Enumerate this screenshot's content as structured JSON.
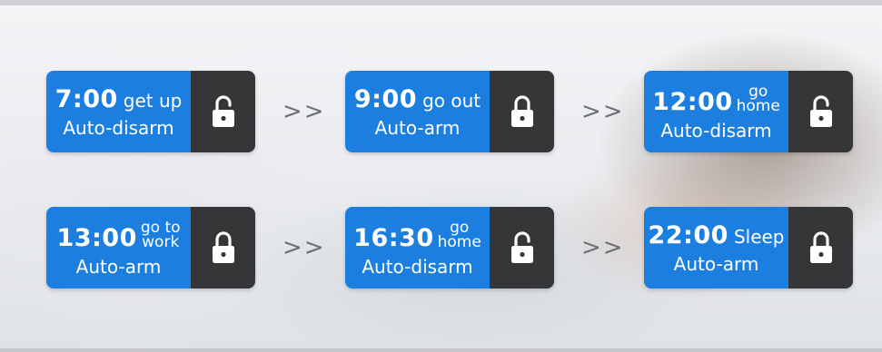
{
  "schedule": [
    {
      "time": "7:00",
      "event": "get up",
      "stacked": false,
      "action": "Auto-disarm",
      "icon": "padlock-icon"
    },
    {
      "time": "9:00",
      "event": "go out",
      "stacked": false,
      "action": "Auto-arm",
      "icon": "padlock-icon"
    },
    {
      "time": "12:00",
      "event_line1": "go",
      "event_line2": "home",
      "stacked": true,
      "action": "Auto-disarm",
      "icon": "padlock-icon"
    },
    {
      "time": "13:00",
      "event_line1": "go to",
      "event_line2": "work",
      "stacked": true,
      "action": "Auto-arm",
      "icon": "padlock-icon"
    },
    {
      "time": "16:30",
      "event_line1": "go",
      "event_line2": "home",
      "stacked": true,
      "action": "Auto-disarm",
      "icon": "padlock-icon"
    },
    {
      "time": "22:00",
      "event": "Sleep",
      "stacked": false,
      "action": "Auto-arm",
      "icon": "padlock-icon"
    }
  ],
  "arrow_symbol": ">>",
  "colors": {
    "card_blue": "#1c7fe0",
    "lock_panel": "#343638",
    "arrow_gray": "#6d7075"
  }
}
